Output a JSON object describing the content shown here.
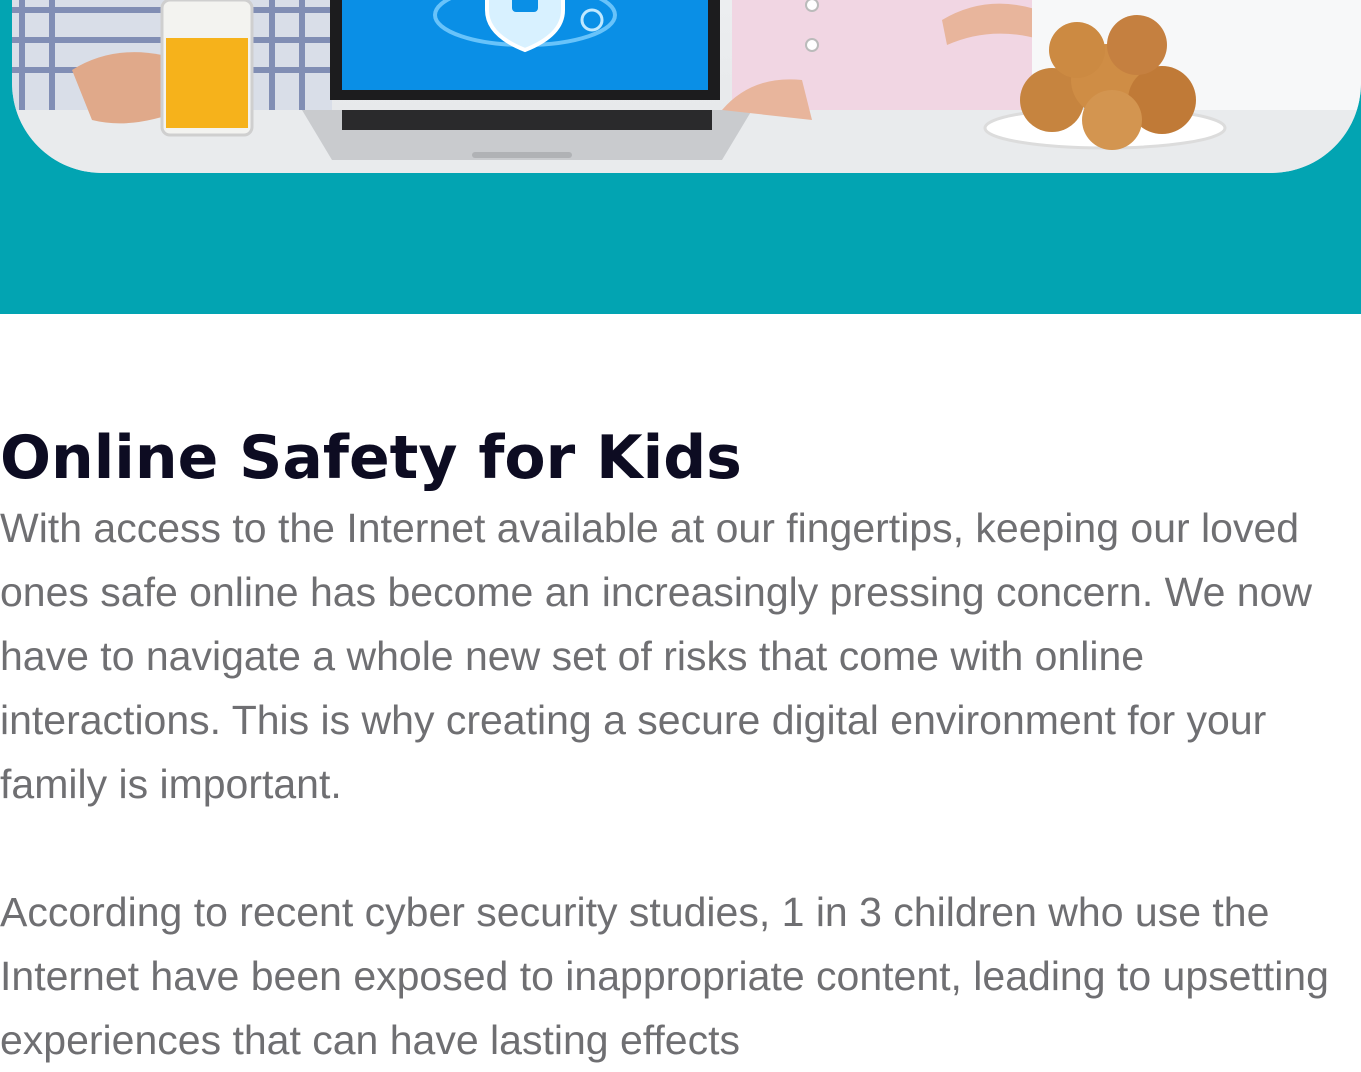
{
  "article": {
    "title": "Online Safety for Kids",
    "paragraphs": [
      "With access to the Internet available at our fingertips, keeping our loved ones safe online has become an increasingly pressing concern. We now have to navigate a whole new set of risks that come with online interactions. This is why creating a secure digital environment for your family is important.",
      "According to recent cyber security studies, 1 in 3 children who use the Internet have been exposed to inappropriate content, leading to upsetting experiences that can have lasting effects"
    ]
  },
  "colors": {
    "hero_background": "#02a4b2",
    "title": "#0d0c22",
    "body_text": "#6f6f72",
    "laptop_screen": "#0a8fe6"
  },
  "icons": [
    "shield-icon"
  ]
}
